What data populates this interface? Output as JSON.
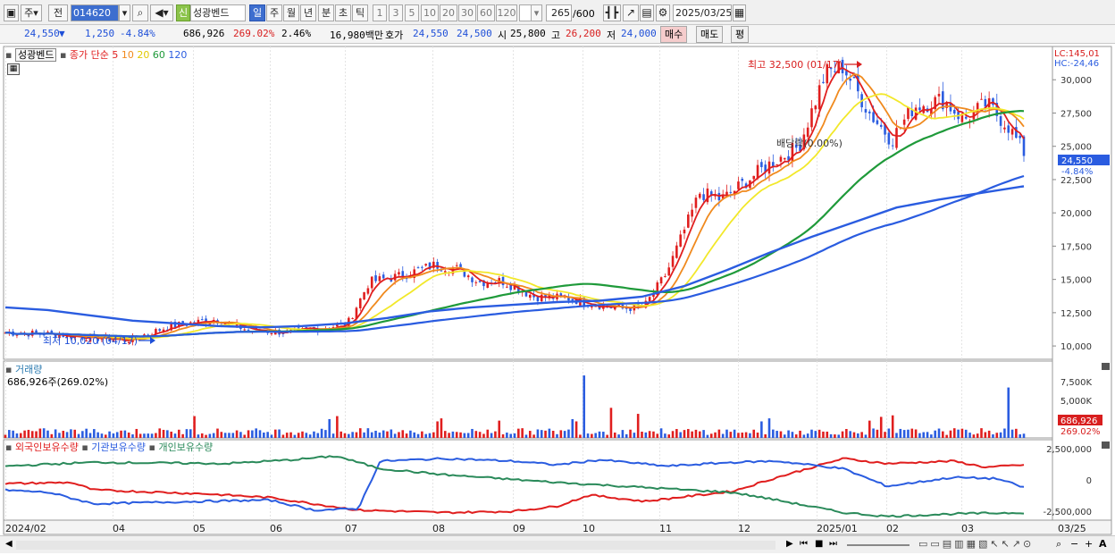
{
  "toolbar": {
    "mode_item": "주",
    "prev_label": "전",
    "stock_code": "014620",
    "new_badge": "신",
    "stock_name": "성광벤드",
    "periods": [
      "일",
      "주",
      "월",
      "년",
      "분",
      "초",
      "틱"
    ],
    "active_period": "일",
    "minutes": [
      "1",
      "3",
      "5",
      "10",
      "20",
      "30",
      "60",
      "120"
    ],
    "count_value": "265",
    "count_total": "/600",
    "date": "2025/03/25"
  },
  "info": {
    "price": "24,550",
    "arrow": "▼",
    "change": "1,250",
    "change_pct": "-4.84%",
    "volume": "686,926",
    "vol_ratio": "269.02%",
    "turnover": "2.46%",
    "amount": "16,980백만",
    "hoga_label": "호가",
    "ask": "24,550",
    "bid": "24,500",
    "open_label": "시",
    "open": "25,800",
    "high_label": "고",
    "high": "26,200",
    "low_label": "저",
    "low": "24,000",
    "buy_button": "매수",
    "sell_button": "매도",
    "avg_button": "평"
  },
  "price_panel": {
    "indicator_name": "성광벤드",
    "ma_prefix": "종가 단순",
    "ma_periods": [
      "5",
      "10",
      "20",
      "60",
      "120"
    ],
    "ma_colors": [
      "#e01e1e",
      "#f08a1e",
      "#f2e82a",
      "#1f9a3a",
      "#2a5ce0"
    ],
    "lc_label": "LC:145,01",
    "hc_label": "HC:-24,46",
    "y_ticks": [
      "30,000",
      "27,500",
      "25,000",
      "22,500",
      "20,000",
      "17,500",
      "15,000",
      "12,500",
      "10,000"
    ],
    "max_annotation": "최고 32,500 (01/17)",
    "min_annotation": "최저 10,020 (04/17)",
    "dividend_annotation": "배당락(0.00%)",
    "current_price_tag": "24,550",
    "current_change_tag": "-4.84%"
  },
  "volume_panel": {
    "title": "거래량",
    "value_text": "686,926주(269.02%)",
    "y_ticks": [
      "7,500K",
      "5,000K",
      "2,500K"
    ],
    "current_tag": "686,926",
    "ratio_tag": "269.02%"
  },
  "holding_panel": {
    "series": [
      {
        "name": "외국인보유수량",
        "color": "#e01e1e"
      },
      {
        "name": "기관보유수량",
        "color": "#2a5ce0"
      },
      {
        "name": "개인보유수량",
        "color": "#2a8a5a"
      }
    ],
    "y_ticks": [
      "2,500,000",
      "0",
      "-2,500,000"
    ]
  },
  "x_axis": {
    "labels": [
      "2024/02",
      "04",
      "05",
      "06",
      "07",
      "08",
      "09",
      "10",
      "11",
      "12",
      "2025/01",
      "02",
      "03",
      "03/25"
    ]
  },
  "chart_data": {
    "type": "line",
    "title": "성광벤드",
    "xlabel": "",
    "ylabel": "",
    "ylim": [
      9000,
      32500
    ],
    "series": [
      {
        "name": "종가 단순 5",
        "values": [
          11000,
          11200,
          11000,
          11500,
          12000,
          11800,
          11500,
          11200,
          11600,
          14800,
          15300,
          16200,
          15600,
          14500,
          13700,
          13200,
          15800,
          22000,
          24500,
          25800,
          31000,
          27000,
          28500,
          27500,
          24550
        ]
      },
      {
        "name": "종가 단순 120",
        "values": [
          12900,
          12700,
          12300,
          11900,
          11700,
          11500,
          11400,
          11500,
          11700,
          12100,
          12600,
          12900,
          13100,
          13300,
          13400,
          13700,
          14500,
          15700,
          17000,
          18200,
          19300,
          20400,
          21000,
          21500,
          22000
        ]
      }
    ]
  }
}
